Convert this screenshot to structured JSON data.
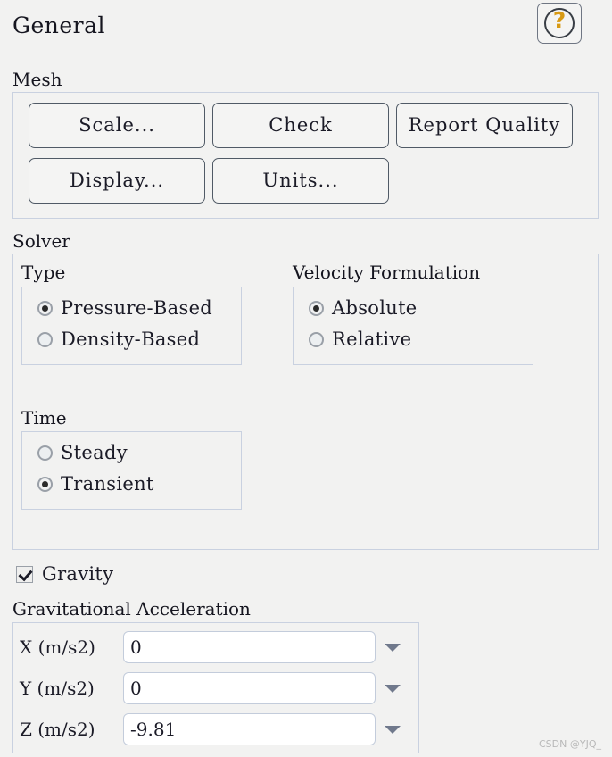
{
  "panel": {
    "title": "General",
    "help_icon_glyph": "?",
    "watermark": "CSDN @YJQ_"
  },
  "mesh": {
    "label": "Mesh",
    "buttons": [
      {
        "label": "Scale..."
      },
      {
        "label": "Check"
      },
      {
        "label": "Report Quality"
      },
      {
        "label": "Display..."
      },
      {
        "label": "Units..."
      }
    ]
  },
  "solver": {
    "label": "Solver",
    "type": {
      "label": "Type",
      "options": [
        {
          "label": "Pressure-Based",
          "selected": true
        },
        {
          "label": "Density-Based",
          "selected": false
        }
      ]
    },
    "velocity_formulation": {
      "label": "Velocity Formulation",
      "options": [
        {
          "label": "Absolute",
          "selected": true
        },
        {
          "label": "Relative",
          "selected": false
        }
      ]
    },
    "time": {
      "label": "Time",
      "options": [
        {
          "label": "Steady",
          "selected": false
        },
        {
          "label": "Transient",
          "selected": true
        }
      ]
    }
  },
  "gravity": {
    "checkbox_label": "Gravity",
    "checked": true,
    "acceleration_label": "Gravitational Acceleration",
    "fields": [
      {
        "label": "X (m/s2)",
        "value": "0"
      },
      {
        "label": "Y (m/s2)",
        "value": "0"
      },
      {
        "label": "Z (m/s2)",
        "value": "-9.81"
      }
    ]
  },
  "colors": {
    "panel_background": "#f2f2f1",
    "group_border": "#c9d1e0",
    "button_border": "#505a66",
    "text": "#1b1b27",
    "help_accent": "#d89a14",
    "input_background": "#ffffff",
    "arrow": "#70798c"
  }
}
